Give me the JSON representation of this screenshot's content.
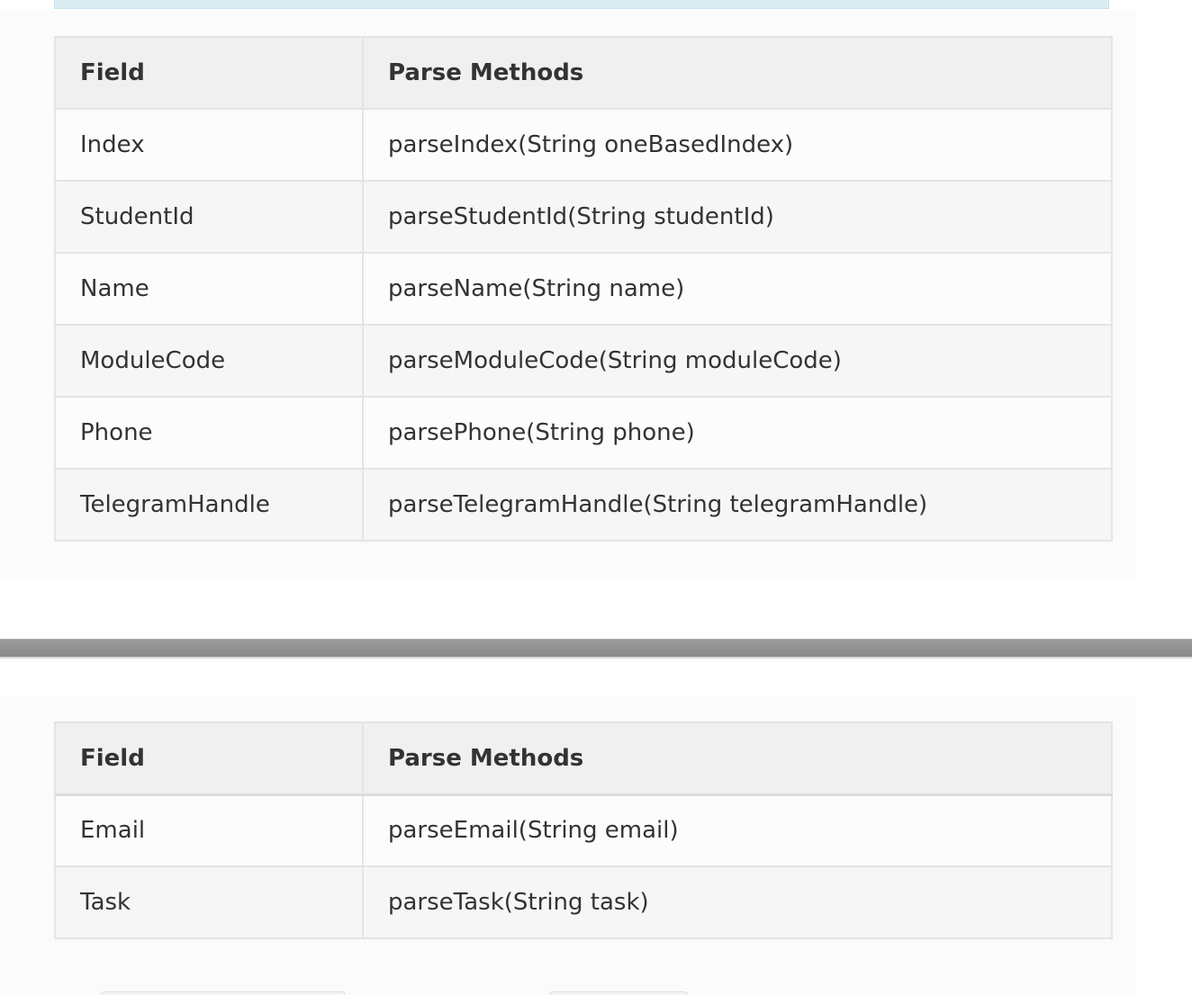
{
  "tables": [
    {
      "headers": [
        "Field",
        "Parse Methods"
      ],
      "rows": [
        [
          "Index",
          "parseIndex(String oneBasedIndex)"
        ],
        [
          "StudentId",
          "parseStudentId(String studentId)"
        ],
        [
          "Name",
          "parseName(String name)"
        ],
        [
          "ModuleCode",
          "parseModuleCode(String moduleCode)"
        ],
        [
          "Phone",
          "parsePhone(String phone)"
        ],
        [
          "TelegramHandle",
          "parseTelegramHandle(String telegramHandle)"
        ]
      ]
    },
    {
      "headers": [
        "Field",
        "Parse Methods"
      ],
      "rows": [
        [
          "Email",
          "parseEmail(String email)"
        ],
        [
          "Task",
          "parseTask(String task)"
        ]
      ]
    }
  ],
  "colors": {
    "callout": "#d9edf3",
    "header_bg": "#f0f0f0",
    "divider": "#8f8f8f",
    "border": "#e4e4e4"
  }
}
